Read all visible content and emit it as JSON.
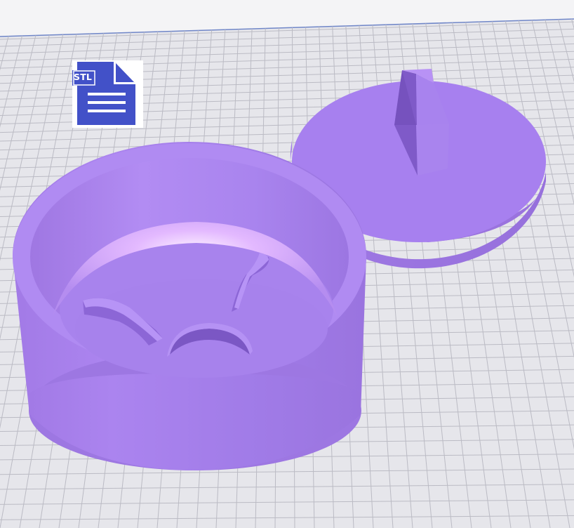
{
  "viewer": {
    "background_color": "#f4f4f6",
    "bed_color": "#e6e6eb",
    "grid_color": "#b9b9c2",
    "model_color": "#a97ff0"
  },
  "file_badge": {
    "icon": "stl-file-icon",
    "label": "STL",
    "color": "#4251c8"
  },
  "models": [
    {
      "name": "round-container-base",
      "icon": "container-base"
    },
    {
      "name": "container-lid-with-handle",
      "icon": "lid"
    }
  ]
}
